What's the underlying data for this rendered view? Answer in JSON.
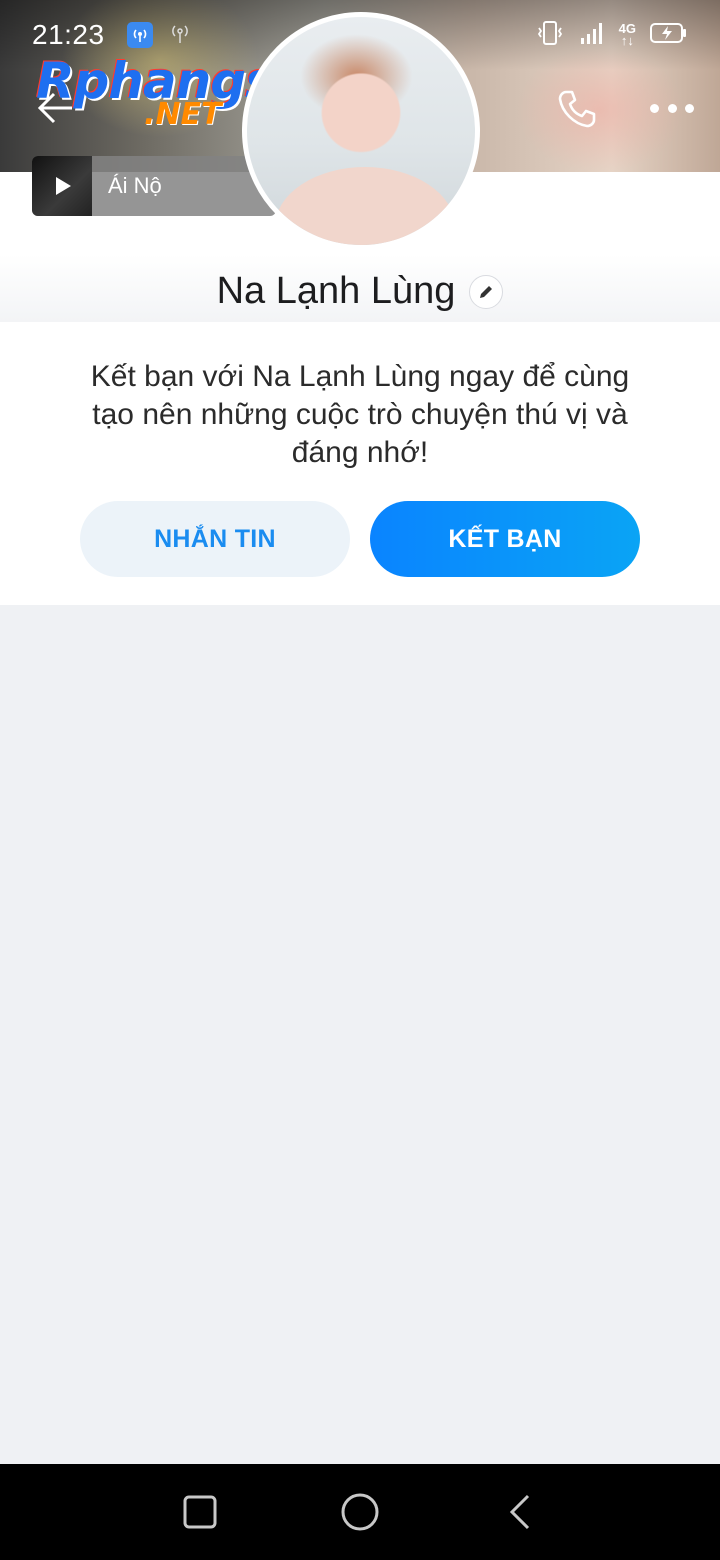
{
  "status_bar": {
    "time": "21:23",
    "network_label_top": "4G",
    "network_label_bottom": "↑↓",
    "icons": [
      "hotspot-icon",
      "wifi-signal-icon",
      "vibrate-icon",
      "cell-signal-icon",
      "battery-charging-icon"
    ]
  },
  "header": {
    "back_icon": "arrow-left-icon",
    "call_icon": "phone-icon",
    "more_icon": "more-dots-icon"
  },
  "watermark": {
    "main": "Rphangs",
    "sub": ".NET"
  },
  "music": {
    "title": "Ái Nộ",
    "play_icon": "play-icon"
  },
  "profile": {
    "name": "Na Lạnh Lùng",
    "edit_icon": "pencil-icon"
  },
  "invite": {
    "text": "Kết bạn với Na Lạnh Lùng ngay để cùng tạo nên những cuộc trò chuyện thú vị và đáng nhớ!",
    "message_button": "NHẮN TIN",
    "add_friend_button": "KẾT BẠN"
  },
  "colors": {
    "accent": "#0a84ff",
    "message_bg": "#ecf3f9",
    "page_bg": "#eff1f4"
  }
}
